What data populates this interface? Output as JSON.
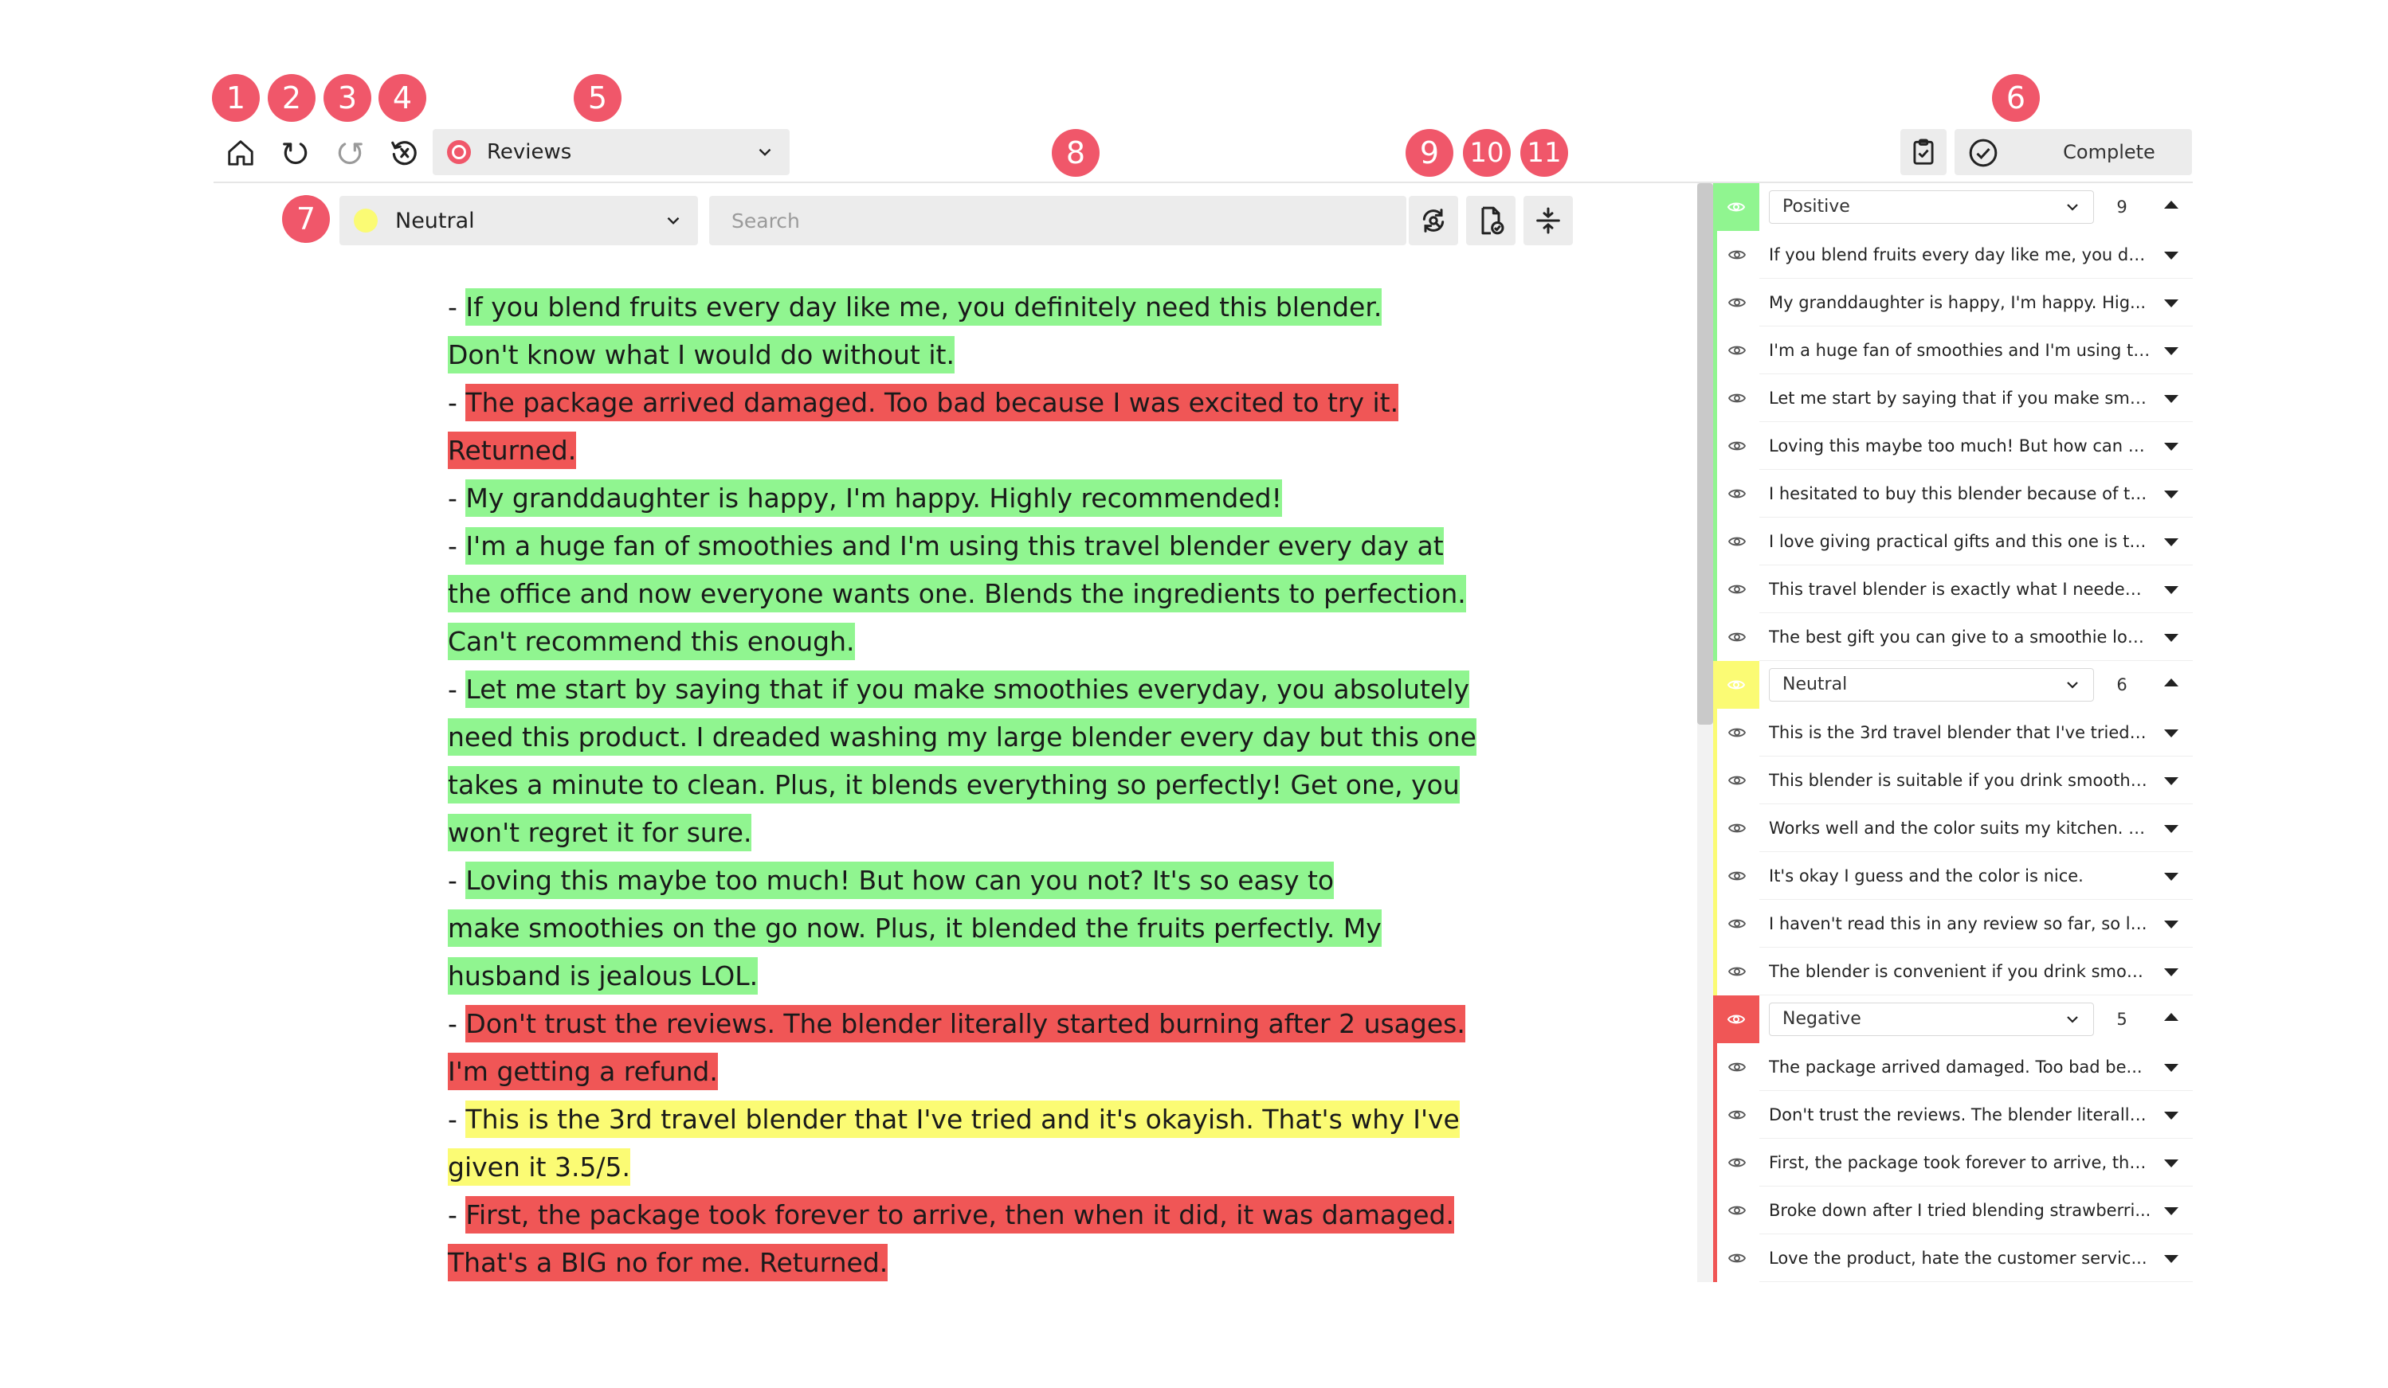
{
  "callouts": [
    "1",
    "2",
    "3",
    "4",
    "5",
    "6",
    "7",
    "8",
    "9",
    "10",
    "11"
  ],
  "toolbar": {
    "icons": [
      "home-icon",
      "undo-icon",
      "redo-icon",
      "history-icon"
    ],
    "file_select": "Reviews",
    "complete_label": "Complete"
  },
  "label_select": "Neutral",
  "search": {
    "placeholder": "Search",
    "value": ""
  },
  "action_icons": [
    "relabel-icon",
    "document-check-icon",
    "collapse-icon"
  ],
  "colors": {
    "positive": "#90f590",
    "neutral": "#fbfb74",
    "negative": "#f05656",
    "badge": "#f0576a"
  },
  "document": [
    {
      "label": "positive",
      "text": "If you blend fruits every day like me, you definitely need this blender. Don't know what I would do without it."
    },
    {
      "label": "negative",
      "text": "The package arrived damaged. Too bad because I was excited to try it. Returned."
    },
    {
      "label": "positive",
      "text": "My granddaughter is happy, I'm happy. Highly recommended!"
    },
    {
      "label": "positive",
      "text": "I'm a huge fan of smoothies and I'm using this travel blender every day at the office and now everyone wants one. Blends the ingredients to perfection. Can't recommend this enough."
    },
    {
      "label": "positive",
      "text": "Let me start by saying that if you make smoothies everyday, you absolutely need this product. I dreaded washing my large blender every day but this one takes a minute to clean. Plus, it blends everything so perfectly! Get one, you won't regret it for sure."
    },
    {
      "label": "positive",
      "text": "Loving this maybe too much! But how can you not? It's so easy to make smoothies on the go now. Plus, it blended the fruits perfectly. My husband is jealous LOL."
    },
    {
      "label": "negative",
      "text": "Don't trust the reviews. The blender literally started burning after 2 usages. I'm getting a refund."
    },
    {
      "label": "neutral",
      "text": "This is the 3rd travel blender that I've tried and it's okayish. That's why I've given it 3.5/5."
    },
    {
      "label": "negative",
      "text": "First, the package took forever to arrive, then when it did, it was damaged. That's a BIG no for me. Returned."
    }
  ],
  "groups": [
    {
      "name": "Positive",
      "count": "9",
      "color": "#90f590",
      "items": [
        "If you blend fruits every day like me, you def...",
        "My granddaughter is happy, I'm happy. Hig...",
        "I'm a huge fan of smoothies and I'm using th...",
        "Let me start by saying that if you make smo...",
        "Loving this maybe too much! But how can y...",
        "I hesitated to buy this blender because of th...",
        "I love giving practical gifts and this one is th...",
        "This travel blender is exactly what I needed ...",
        "The best gift you can give to a smoothie lov..."
      ]
    },
    {
      "name": "Neutral",
      "count": "6",
      "color": "#fbfb74",
      "items": [
        "This is the 3rd travel blender that I've tried a...",
        "This blender is suitable if you drink smoothie...",
        "Works well and the color suits my kitchen. 4...",
        "It's okay I guess and the color is nice.",
        "I haven't read this in any review so far, so let...",
        "The blender is convenient if you drink smoot..."
      ]
    },
    {
      "name": "Negative",
      "count": "5",
      "color": "#f05656",
      "items": [
        "The package arrived damaged. Too bad be...",
        "Don't trust the reviews. The blender literally ...",
        "First, the package took forever to arrive, the...",
        "Broke down after I tried blending strawberri...",
        "Love the product, hate the customer servic..."
      ]
    }
  ]
}
